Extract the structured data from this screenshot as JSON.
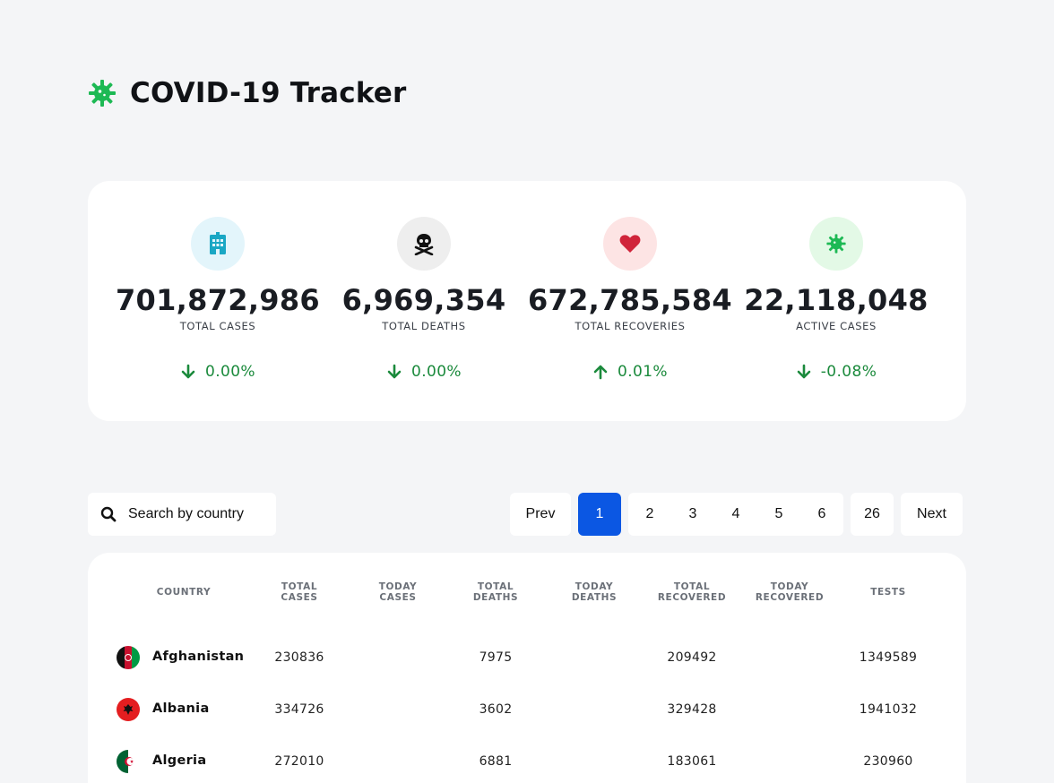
{
  "header": {
    "title": "COVID-19 Tracker",
    "logo_icon": "virus-icon",
    "accent": "#1db954"
  },
  "stats": [
    {
      "value": "701,872,986",
      "label": "TOTAL CASES",
      "change": "0.00%",
      "direction": "down",
      "icon": "hospital-icon",
      "icon_bg": "#e3f5fb",
      "icon_color": "#1aa7c4"
    },
    {
      "value": "6,969,354",
      "label": "TOTAL DEATHS",
      "change": "0.00%",
      "direction": "down",
      "icon": "skull-crossbones-icon",
      "icon_bg": "#eeeeee",
      "icon_color": "#111111"
    },
    {
      "value": "672,785,584",
      "label": "TOTAL RECOVERIES",
      "change": "0.01%",
      "direction": "up",
      "icon": "heart-icon",
      "icon_bg": "#fde4e4",
      "icon_color": "#d0243a"
    },
    {
      "value": "22,118,048",
      "label": "ACTIVE CASES",
      "change": "-0.08%",
      "direction": "down",
      "icon": "virus-icon",
      "icon_bg": "#e3f9e6",
      "icon_color": "#1db954"
    }
  ],
  "search": {
    "placeholder": "Search by country"
  },
  "pagination": {
    "prev": "Prev",
    "current": "1",
    "pages": [
      "2",
      "3",
      "4",
      "5",
      "6"
    ],
    "last": "26",
    "next": "Next",
    "active_color": "#0b57e3"
  },
  "table": {
    "columns": [
      {
        "line1": "COUNTRY",
        "line2": ""
      },
      {
        "line1": "TOTAL",
        "line2": "CASES"
      },
      {
        "line1": "TODAY",
        "line2": "CASES"
      },
      {
        "line1": "TOTAL",
        "line2": "DEATHS"
      },
      {
        "line1": "TODAY",
        "line2": "DEATHS"
      },
      {
        "line1": "TOTAL",
        "line2": "RECOVERED"
      },
      {
        "line1": "TODAY",
        "line2": "RECOVERED"
      },
      {
        "line1": "TESTS",
        "line2": ""
      }
    ],
    "rows": [
      {
        "country": "Afghanistan",
        "flag": "afghanistan-flag",
        "total_cases": "230836",
        "today_cases": "",
        "total_deaths": "7975",
        "today_deaths": "",
        "total_recovered": "209492",
        "today_recovered": "",
        "tests": "1349589"
      },
      {
        "country": "Albania",
        "flag": "albania-flag",
        "total_cases": "334726",
        "today_cases": "",
        "total_deaths": "3602",
        "today_deaths": "",
        "total_recovered": "329428",
        "today_recovered": "",
        "tests": "1941032"
      },
      {
        "country": "Algeria",
        "flag": "algeria-flag",
        "total_cases": "272010",
        "today_cases": "",
        "total_deaths": "6881",
        "today_deaths": "",
        "total_recovered": "183061",
        "today_recovered": "",
        "tests": "230960"
      }
    ]
  }
}
